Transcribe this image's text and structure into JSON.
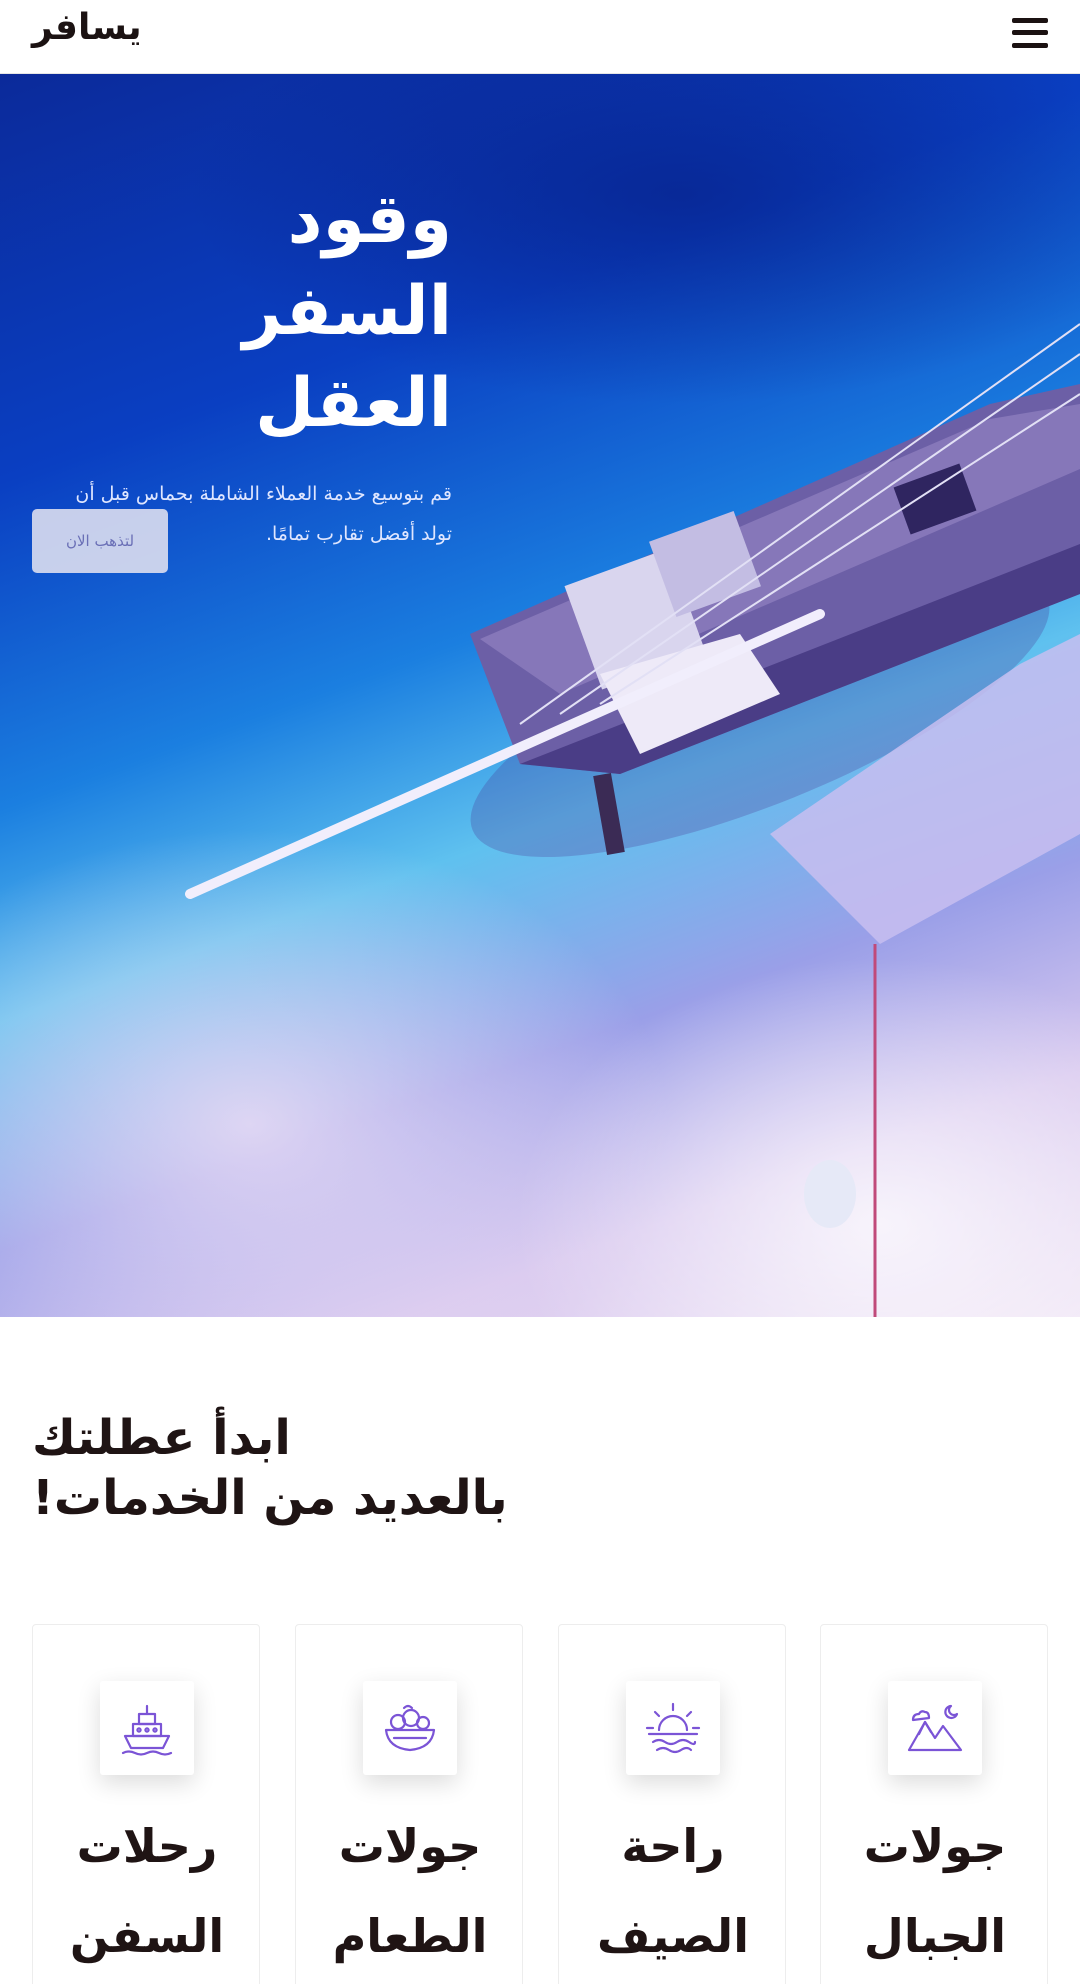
{
  "header": {
    "brand": "يسافر",
    "menu_icon": "hamburger-menu-icon"
  },
  "hero": {
    "title_line1": "وقود",
    "title_line2": "السفر العقل",
    "subtitle_line1": "قم بتوسيع خدمة العملاء الشاملة بحماس قبل أن",
    "subtitle_line2": "تولد أفضل تقارب تمامًا.",
    "button_label": "لتذهب الان"
  },
  "services": {
    "title_line1": "ابدأ عطلتك",
    "title_line2": "بالعديد من الخدمات!",
    "cards": [
      {
        "icon": "ship-icon",
        "label_line1": "رحلات",
        "label_line2": "السفن"
      },
      {
        "icon": "food-bowl-icon",
        "label_line1": "جولات",
        "label_line2": "الطعام"
      },
      {
        "icon": "sunset-icon",
        "label_line1": "راحة",
        "label_line2": "الصيف"
      },
      {
        "icon": "mountains-icon",
        "label_line1": "جولات",
        "label_line2": "الجبال"
      }
    ]
  },
  "colors": {
    "icon_accent": "#7b54d6",
    "text_dark": "#1f1414",
    "hero_deep_blue": "#0a3fc2"
  }
}
